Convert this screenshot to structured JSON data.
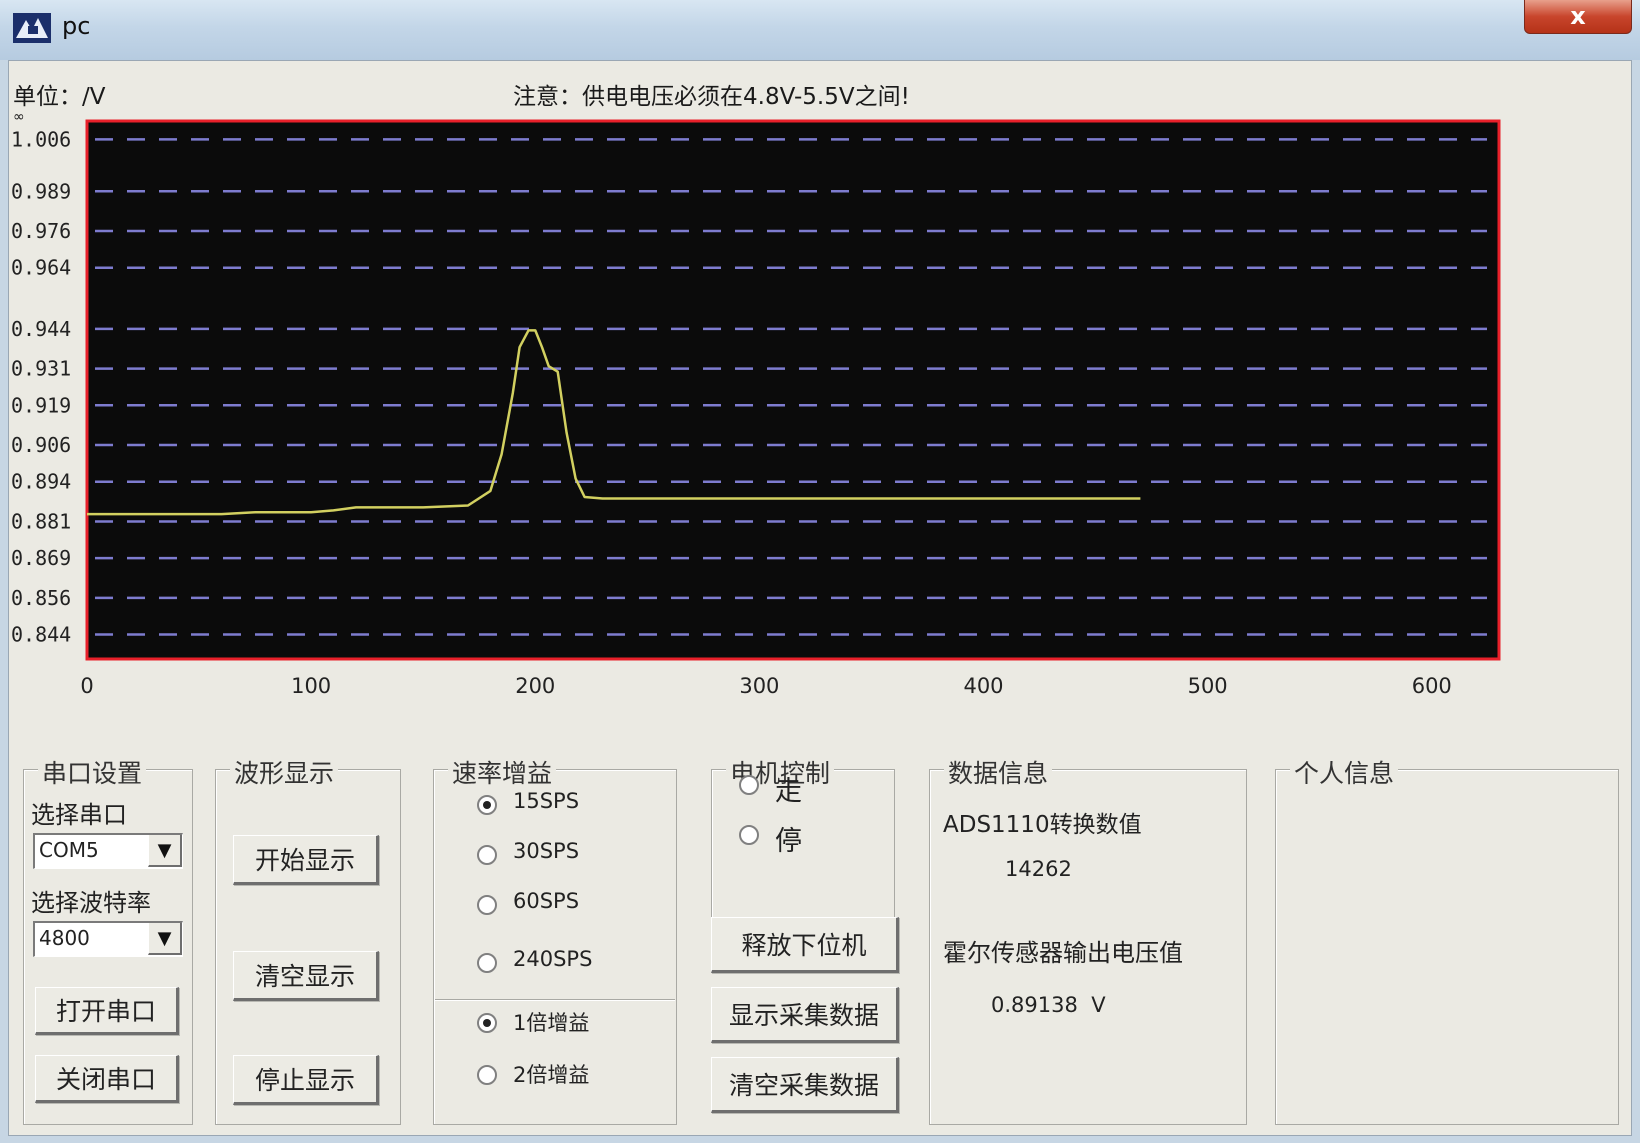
{
  "window": {
    "title": "pc",
    "close_glyph": "x",
    "icon": "app-logo-icon"
  },
  "header": {
    "unit_label": "单位：/V",
    "warning": "注意：供电电压必须在4.8V-5.5V之间!",
    "infinity_mark": "∞"
  },
  "chart_data": {
    "type": "line",
    "xlim": [
      0,
      630
    ],
    "x_ticks": [
      "0",
      "100",
      "200",
      "300",
      "400",
      "500",
      "600"
    ],
    "x_tick_values": [
      0,
      100,
      200,
      300,
      400,
      500,
      600
    ],
    "y_ticks": [
      "1.006",
      "0.989",
      "0.976",
      "0.964",
      "0.944",
      "0.931",
      "0.919",
      "0.906",
      "0.894",
      "0.881",
      "0.869",
      "0.856",
      "0.844"
    ],
    "y_tick_values": [
      1.006,
      0.989,
      0.976,
      0.964,
      0.944,
      0.931,
      0.919,
      0.906,
      0.894,
      0.881,
      0.869,
      0.856,
      0.844
    ],
    "ylim": [
      0.836,
      1.012
    ],
    "grid": true,
    "series": [
      {
        "x": [
          0,
          60,
          75,
          100,
          110,
          120,
          150,
          170,
          180,
          185,
          190,
          193,
          197,
          200,
          203,
          206,
          210,
          214,
          218,
          222,
          230,
          260,
          300,
          350,
          400,
          450,
          470
        ],
        "y": [
          0.8834,
          0.8834,
          0.884,
          0.884,
          0.8846,
          0.8856,
          0.8856,
          0.8862,
          0.891,
          0.903,
          0.923,
          0.938,
          0.9435,
          0.9435,
          0.938,
          0.9318,
          0.93,
          0.91,
          0.895,
          0.889,
          0.8885,
          0.8885,
          0.8885,
          0.8885,
          0.8885,
          0.8885,
          0.8885
        ]
      }
    ],
    "colors": {
      "background": "#0b0b0b",
      "frame": "#e8202a",
      "grid": "#7e7ccf",
      "line": "#d2d060"
    }
  },
  "serial": {
    "group_title": "串口设置",
    "port_label": "选择串口",
    "port_value": "COM5",
    "baud_label": "选择波特率",
    "baud_value": "4800",
    "open_button": "打开串口",
    "close_button": "关闭串口"
  },
  "waveform": {
    "group_title": "波形显示",
    "start_button": "开始显示",
    "clear_button": "清空显示",
    "stop_button": "停止显示"
  },
  "rate_gain": {
    "group_title": "速率增益",
    "rates": [
      {
        "label": "15SPS",
        "selected": true
      },
      {
        "label": "30SPS",
        "selected": false
      },
      {
        "label": "60SPS",
        "selected": false
      },
      {
        "label": "240SPS",
        "selected": false
      }
    ],
    "gains": [
      {
        "label": "1倍增益",
        "selected": true
      },
      {
        "label": "2倍增益",
        "selected": false
      }
    ]
  },
  "motor": {
    "group_title": "电机控制",
    "go_label": "走",
    "go_selected": false,
    "stop_label": "停",
    "stop_selected": false,
    "release_button": "释放下位机",
    "show_data_button": "显示采集数据",
    "clear_data_button": "清空采集数据"
  },
  "data_info": {
    "group_title": "数据信息",
    "ads_label": "ADS1110转换数值",
    "ads_value": "14262",
    "hall_label": "霍尔传感器输出电压值",
    "hall_value": "0.89138  V"
  },
  "personal": {
    "group_title": "个人信息"
  }
}
